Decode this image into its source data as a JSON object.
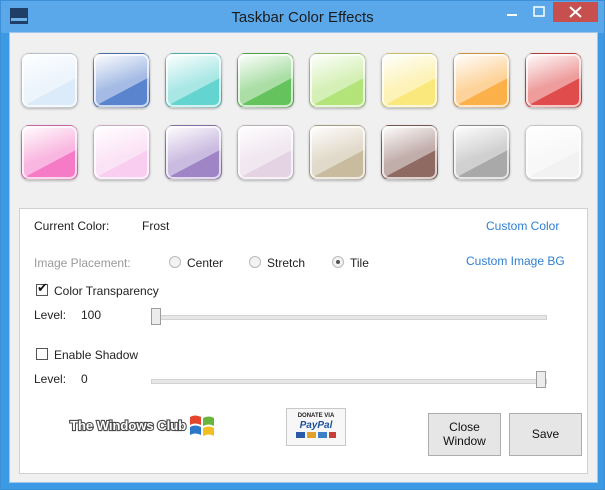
{
  "window": {
    "title": "Taskbar Color Effects",
    "icon": "app-icon",
    "caption_buttons": [
      "minimize-icon",
      "maximize-icon",
      "close-icon"
    ]
  },
  "swatches": [
    {
      "name": "frost",
      "color": "#dcebfa"
    },
    {
      "name": "blue",
      "color": "#5b84cf"
    },
    {
      "name": "aqua",
      "color": "#63d4d0"
    },
    {
      "name": "green",
      "color": "#64c35c"
    },
    {
      "name": "lime",
      "color": "#b2e47a"
    },
    {
      "name": "yellow",
      "color": "#fbe87c"
    },
    {
      "name": "orange",
      "color": "#fbb04a"
    },
    {
      "name": "red",
      "color": "#e04b4b"
    },
    {
      "name": "pink",
      "color": "#f57bc6"
    },
    {
      "name": "light-pink",
      "color": "#f8cdef"
    },
    {
      "name": "violet",
      "color": "#9f84c6"
    },
    {
      "name": "lavender",
      "color": "#e3d3e3"
    },
    {
      "name": "beige",
      "color": "#c9bb9e"
    },
    {
      "name": "brown",
      "color": "#8e6a63"
    },
    {
      "name": "gray",
      "color": "#a9a9a9"
    },
    {
      "name": "white",
      "color": "#f2f2f2"
    }
  ],
  "current_color": {
    "label": "Current Color:",
    "value": "Frost"
  },
  "custom_color_link": "Custom Color",
  "image_placement": {
    "label": "Image Placement:",
    "options": [
      "Center",
      "Stretch",
      "Tile"
    ],
    "selected": "Tile"
  },
  "custom_image_link": "Custom Image BG",
  "color_transparency": {
    "label": "Color Transparency",
    "checked": true,
    "level_label": "Level:",
    "level": "100"
  },
  "enable_shadow": {
    "label": "Enable Shadow",
    "checked": false,
    "level_label": "Level:",
    "level": "0"
  },
  "logo_text": "The Windows Club",
  "paypal": {
    "line1": "DONATE VIA",
    "line2": "PayPal"
  },
  "buttons": {
    "close_window": [
      "Close",
      "Window"
    ],
    "save": "Save"
  }
}
